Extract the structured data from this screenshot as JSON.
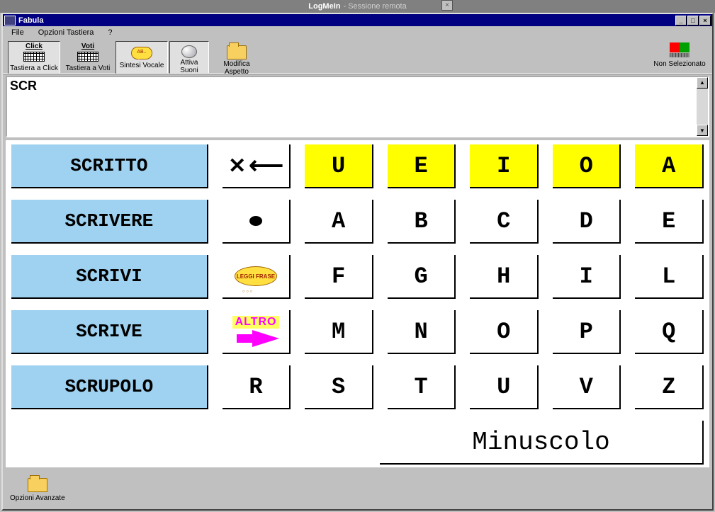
{
  "outer": {
    "app": "LogMeIn",
    "sub": "- Sessione remota"
  },
  "window": {
    "title": "Fabula"
  },
  "menu": {
    "file": "File",
    "options": "Opzioni Tastiera",
    "help": "?"
  },
  "toolbar": {
    "click_top": "Click",
    "click_label": "Tastiera a Click",
    "voti_top": "Voti",
    "voti_label": "Tastiera a Voti",
    "sintesi_label": "Sintesi Vocale",
    "sintesi_bubble": "AB..",
    "suoni_label": "Attiva Suoni",
    "aspetto_label": "Modifica Aspetto",
    "nonsel_label": "Non Selezionato"
  },
  "text_value": "SCR",
  "words": [
    "SCRITTO",
    "SCRIVERE",
    "SCRIVI",
    "SCRIVE",
    "SCRUPOLO"
  ],
  "func": {
    "leggi": "LEGGI FRASE",
    "altro": "ALTRO"
  },
  "rows": [
    [
      "U",
      "E",
      "I",
      "O",
      "A"
    ],
    [
      "A",
      "B",
      "C",
      "D",
      "E"
    ],
    [
      "F",
      "G",
      "H",
      "I",
      "L"
    ],
    [
      "M",
      "N",
      "O",
      "P",
      "Q"
    ],
    [
      "S",
      "T",
      "U",
      "V",
      "Z"
    ]
  ],
  "extra_key_row5_first": "R",
  "case_label": "Minuscolo",
  "bottom": {
    "advanced": "Opzioni Avanzate"
  }
}
